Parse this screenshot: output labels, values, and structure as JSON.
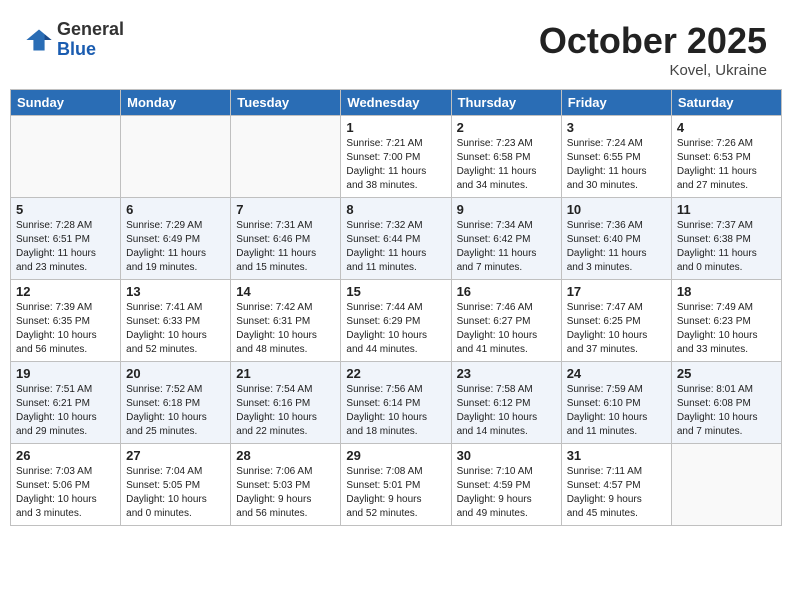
{
  "header": {
    "logo": {
      "general": "General",
      "blue": "Blue"
    },
    "title": "October 2025",
    "location": "Kovel, Ukraine"
  },
  "calendar": {
    "headers": [
      "Sunday",
      "Monday",
      "Tuesday",
      "Wednesday",
      "Thursday",
      "Friday",
      "Saturday"
    ],
    "weeks": [
      [
        {
          "day": "",
          "info": ""
        },
        {
          "day": "",
          "info": ""
        },
        {
          "day": "",
          "info": ""
        },
        {
          "day": "1",
          "info": "Sunrise: 7:21 AM\nSunset: 7:00 PM\nDaylight: 11 hours\nand 38 minutes."
        },
        {
          "day": "2",
          "info": "Sunrise: 7:23 AM\nSunset: 6:58 PM\nDaylight: 11 hours\nand 34 minutes."
        },
        {
          "day": "3",
          "info": "Sunrise: 7:24 AM\nSunset: 6:55 PM\nDaylight: 11 hours\nand 30 minutes."
        },
        {
          "day": "4",
          "info": "Sunrise: 7:26 AM\nSunset: 6:53 PM\nDaylight: 11 hours\nand 27 minutes."
        }
      ],
      [
        {
          "day": "5",
          "info": "Sunrise: 7:28 AM\nSunset: 6:51 PM\nDaylight: 11 hours\nand 23 minutes."
        },
        {
          "day": "6",
          "info": "Sunrise: 7:29 AM\nSunset: 6:49 PM\nDaylight: 11 hours\nand 19 minutes."
        },
        {
          "day": "7",
          "info": "Sunrise: 7:31 AM\nSunset: 6:46 PM\nDaylight: 11 hours\nand 15 minutes."
        },
        {
          "day": "8",
          "info": "Sunrise: 7:32 AM\nSunset: 6:44 PM\nDaylight: 11 hours\nand 11 minutes."
        },
        {
          "day": "9",
          "info": "Sunrise: 7:34 AM\nSunset: 6:42 PM\nDaylight: 11 hours\nand 7 minutes."
        },
        {
          "day": "10",
          "info": "Sunrise: 7:36 AM\nSunset: 6:40 PM\nDaylight: 11 hours\nand 3 minutes."
        },
        {
          "day": "11",
          "info": "Sunrise: 7:37 AM\nSunset: 6:38 PM\nDaylight: 11 hours\nand 0 minutes."
        }
      ],
      [
        {
          "day": "12",
          "info": "Sunrise: 7:39 AM\nSunset: 6:35 PM\nDaylight: 10 hours\nand 56 minutes."
        },
        {
          "day": "13",
          "info": "Sunrise: 7:41 AM\nSunset: 6:33 PM\nDaylight: 10 hours\nand 52 minutes."
        },
        {
          "day": "14",
          "info": "Sunrise: 7:42 AM\nSunset: 6:31 PM\nDaylight: 10 hours\nand 48 minutes."
        },
        {
          "day": "15",
          "info": "Sunrise: 7:44 AM\nSunset: 6:29 PM\nDaylight: 10 hours\nand 44 minutes."
        },
        {
          "day": "16",
          "info": "Sunrise: 7:46 AM\nSunset: 6:27 PM\nDaylight: 10 hours\nand 41 minutes."
        },
        {
          "day": "17",
          "info": "Sunrise: 7:47 AM\nSunset: 6:25 PM\nDaylight: 10 hours\nand 37 minutes."
        },
        {
          "day": "18",
          "info": "Sunrise: 7:49 AM\nSunset: 6:23 PM\nDaylight: 10 hours\nand 33 minutes."
        }
      ],
      [
        {
          "day": "19",
          "info": "Sunrise: 7:51 AM\nSunset: 6:21 PM\nDaylight: 10 hours\nand 29 minutes."
        },
        {
          "day": "20",
          "info": "Sunrise: 7:52 AM\nSunset: 6:18 PM\nDaylight: 10 hours\nand 25 minutes."
        },
        {
          "day": "21",
          "info": "Sunrise: 7:54 AM\nSunset: 6:16 PM\nDaylight: 10 hours\nand 22 minutes."
        },
        {
          "day": "22",
          "info": "Sunrise: 7:56 AM\nSunset: 6:14 PM\nDaylight: 10 hours\nand 18 minutes."
        },
        {
          "day": "23",
          "info": "Sunrise: 7:58 AM\nSunset: 6:12 PM\nDaylight: 10 hours\nand 14 minutes."
        },
        {
          "day": "24",
          "info": "Sunrise: 7:59 AM\nSunset: 6:10 PM\nDaylight: 10 hours\nand 11 minutes."
        },
        {
          "day": "25",
          "info": "Sunrise: 8:01 AM\nSunset: 6:08 PM\nDaylight: 10 hours\nand 7 minutes."
        }
      ],
      [
        {
          "day": "26",
          "info": "Sunrise: 7:03 AM\nSunset: 5:06 PM\nDaylight: 10 hours\nand 3 minutes."
        },
        {
          "day": "27",
          "info": "Sunrise: 7:04 AM\nSunset: 5:05 PM\nDaylight: 10 hours\nand 0 minutes."
        },
        {
          "day": "28",
          "info": "Sunrise: 7:06 AM\nSunset: 5:03 PM\nDaylight: 9 hours\nand 56 minutes."
        },
        {
          "day": "29",
          "info": "Sunrise: 7:08 AM\nSunset: 5:01 PM\nDaylight: 9 hours\nand 52 minutes."
        },
        {
          "day": "30",
          "info": "Sunrise: 7:10 AM\nSunset: 4:59 PM\nDaylight: 9 hours\nand 49 minutes."
        },
        {
          "day": "31",
          "info": "Sunrise: 7:11 AM\nSunset: 4:57 PM\nDaylight: 9 hours\nand 45 minutes."
        },
        {
          "day": "",
          "info": ""
        }
      ]
    ]
  }
}
